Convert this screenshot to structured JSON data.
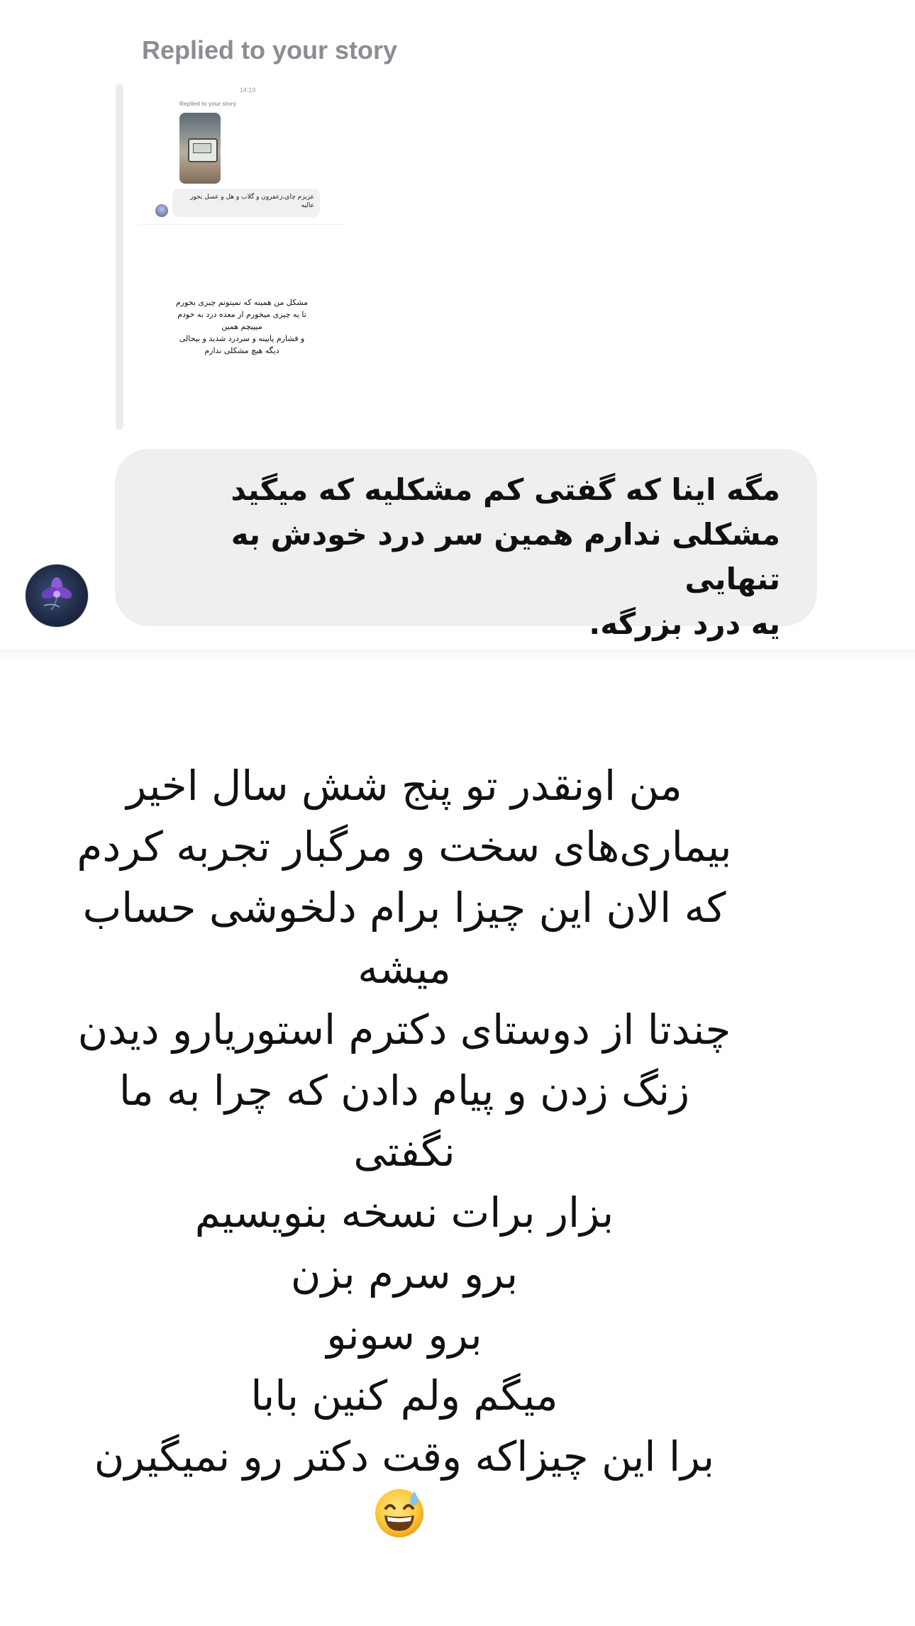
{
  "header": {
    "replied_label": "Replied to your story"
  },
  "story_preview": {
    "time": "14:19",
    "replied_label": "Replied to your story",
    "reply_text": "عزیزم چای،زعفرون و گلاب و هل و عسل بخور عالیه",
    "story_text": "مشکل من همینه که نمیتونم چیزی بخورم\nتا یه چیزی میخورم از معده درد به خودم\nمیپیچم همین\nو فشارم پایینه و سردرد شدید و بیحالی\nدیگه هیچ مشکلی ندارم"
  },
  "message": {
    "text": "مگه اینا که گفتی کم مشکلیه که میگید\nمشکلی ندارم همین سر درد خودش به تنهایی\nیه درد بزرگه."
  },
  "story_caption": {
    "text": "من اونقدر تو پنج شش سال اخیر\nبیماری‌های سخت و مرگبار تجربه کردم\nکه الان این چیزا برام دلخوشی حساب\nمیشه\nچندتا از دوستای دکترم استوریارو دیدن\nزنگ زدن و پیام دادن که چرا به ما نگفتی\nبزار برات نسخه بنویسیم\nبرو سرم بزن\nبرو سونو\nمیگم ولم کنین بابا",
    "last_line": "برا این چیزاکه وقت دکتر رو نمیگیرن",
    "emoji": "grinning-sweat-face"
  },
  "colors": {
    "bubble": "#efeff1",
    "label_gray": "#8a8d93",
    "text": "#111111"
  }
}
